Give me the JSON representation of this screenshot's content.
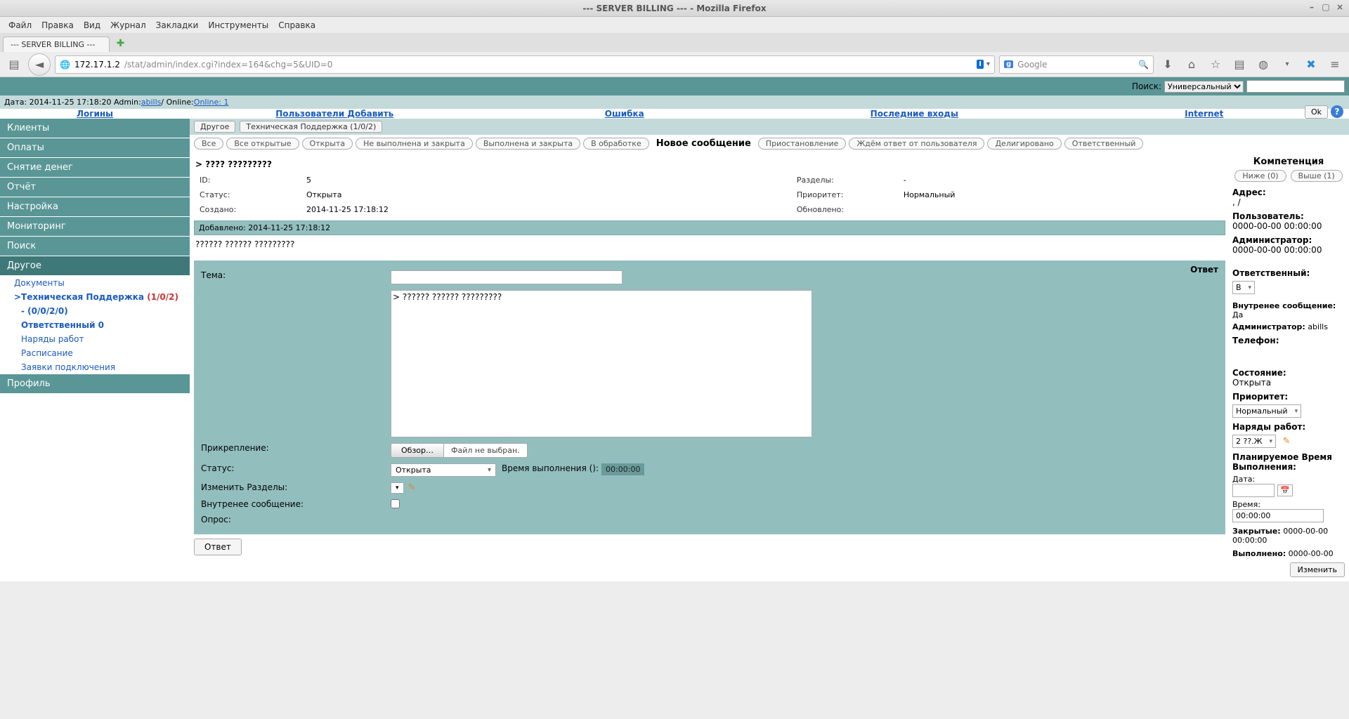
{
  "window": {
    "title": "--- SERVER BILLING --- - Mozilla Firefox"
  },
  "ff": {
    "menus": [
      "Файл",
      "Правка",
      "Вид",
      "Журнал",
      "Закладки",
      "Инструменты",
      "Справка"
    ],
    "tab": "--- SERVER BILLING ---",
    "url_host": "172.17.1.2",
    "url_path": "/stat/admin/index.cgi?index=164&chg=5&UID=0",
    "url_badge": "I",
    "search_placeholder": "Google"
  },
  "topbar": {
    "search_label": "Поиск:",
    "search_type": "Универсальный"
  },
  "infobar": {
    "prefix": "Дата: 2014-11-25 17:18:20 Admin: ",
    "admin": "abills",
    "middle": " / Online: ",
    "online": "Online: 1",
    "ok": "Ok"
  },
  "linkrow": [
    "Логины",
    "Пользователи Добавить",
    "Ошибка",
    "Последние входы",
    "Internet"
  ],
  "sidebar": {
    "items": [
      "Клиенты",
      "Оплаты",
      "Снятие денег",
      "Отчёт",
      "Настройка",
      "Мониторинг",
      "Поиск",
      "Другое"
    ],
    "subs": {
      "docs": "Документы",
      "tech_prefix": ">Техническая Поддержка ",
      "tech_counts": "(1/0/2)",
      "dash": "- (0/0/2/0)",
      "resp": "Ответственный 0",
      "work": "Наряды работ",
      "sched": "Расписание",
      "conn": "Заявки подключения"
    },
    "profile": "Профиль"
  },
  "tabs": {
    "other": "Другое",
    "tech": "Техническая Поддержка (1/0/2)"
  },
  "filters": {
    "items": [
      "Все",
      "Все открытые",
      "Открыта",
      "Не выполнена и закрыта",
      "Выполнена и закрыта",
      "В обработке"
    ],
    "newmsg": "Новое сообщение",
    "items2": [
      "Приостановление",
      "Ждём ответ от пользователя",
      "Делигировано",
      "Ответственный"
    ]
  },
  "ticket": {
    "title": "> ???? ?????????",
    "id_lbl": "ID:",
    "id_val": "5",
    "sections_lbl": "Разделы:",
    "sections_val": "-",
    "status_lbl": "Статус:",
    "status_val": "Открыта",
    "prio_lbl": "Приоритет:",
    "prio_val": "Нормальный",
    "created_lbl": "Создано:",
    "created_val": "2014-11-25 17:18:12",
    "updated_lbl": "Обновлено:",
    "log": "Добавленo: 2014-11-25 17:18:12",
    "body": "?????? ?????? ?????????"
  },
  "reply": {
    "panel_label": "Ответ",
    "subject_lbl": "Тема:",
    "textarea_value": "> ?????? ?????? ?????????",
    "attach_lbl": "Прикрепление:",
    "browse": "Обзор…",
    "nofile": "Файл не выбран.",
    "status_lbl": "Статус:",
    "status_val": "Открыта",
    "exec_time_lbl": "Время выполнения ():",
    "exec_time_val": "00:00:00",
    "sections_lbl": "Изменить Разделы:",
    "internal_lbl": "Внутренее сообщение:",
    "poll_lbl": "Опрос:",
    "submit": "Ответ"
  },
  "side": {
    "comp_title": "Компетенция",
    "lower": "Ниже (0)",
    "higher": "Выше (1)",
    "addr_lbl": "Адрес:",
    "addr_val": ", /",
    "user_lbl": "Пользователь:",
    "user_val": "0000-00-00 00:00:00",
    "admin_lbl": "Администратор:",
    "admin_val": "0000-00-00 00:00:00",
    "resp_lbl": "Ответственный:",
    "resp_val": "В",
    "intmsg_lbl": "Внутренее сообщение:",
    "intmsg_val": "Да",
    "admin2_lbl": "Администратор:",
    "admin2_val": "abills",
    "phone_lbl": "Телефон:",
    "state_lbl": "Состояние:",
    "state_val": "Открыта",
    "prio_lbl": "Приоритет:",
    "prio_val": "Нормальный",
    "work_lbl": "Наряды работ:",
    "work_val": "2 ??.Ж",
    "plan_lbl": "Планируемое Время Выполнения:",
    "date_lbl": "Дата:",
    "time_lbl": "Время:",
    "time_val": "00:00:00",
    "closed_lbl": "Закрытые:",
    "closed_val": "0000-00-00 00:00:00",
    "done_lbl": "Выполнено:",
    "done_val": "0000-00-00",
    "change": "Изменить"
  }
}
